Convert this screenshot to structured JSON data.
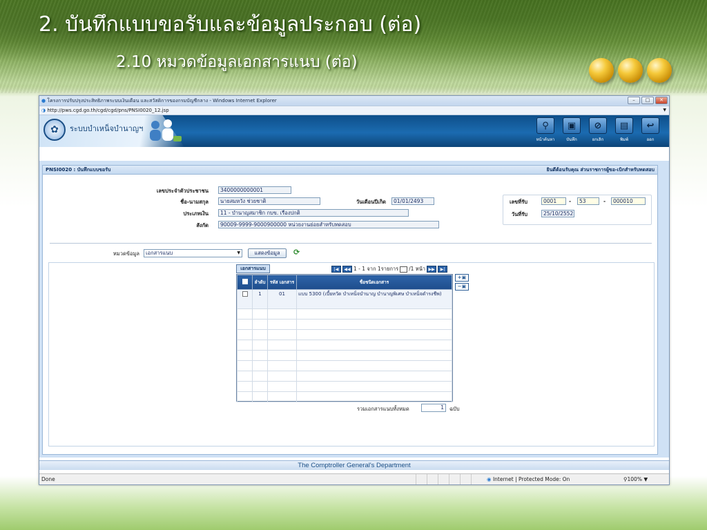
{
  "slide": {
    "title": "2. บันทึกแบบขอรับและข้อมูลประกอบ (ต่อ)",
    "subtitle": "2.10 หมวดข้อมูลเอกสารแนบ (ต่อ)"
  },
  "browser": {
    "window_title": "โครงการปรับปรุงประสิทธิภาพระบบเงินเดือน และสวัสดิการของกรมบัญชีกลาง - Windows Internet Explorer",
    "url": "http://pws.cgd.go.th/cgd/cgd/pns/PNSI0020_12.jsp",
    "status": "Done",
    "zone": "Internet | Protected Mode: On",
    "zoom": "100%"
  },
  "app": {
    "name": "ระบบบำเหน็จบำนาญฯ",
    "toolbar": [
      {
        "label": "หน้าค้นหา",
        "icon": "search-icon"
      },
      {
        "label": "บันทึก",
        "icon": "save-icon"
      },
      {
        "label": "ยกเลิก",
        "icon": "cancel-icon"
      },
      {
        "label": "พิมพ์",
        "icon": "print-icon"
      },
      {
        "label": "ออก",
        "icon": "exit-icon"
      }
    ],
    "footer": "The Comptroller General's Department"
  },
  "form": {
    "screen_title": "PNSI0020 : บันทึกแบบขอรับ",
    "welcome": "ยินดีต้อนรับคุณ ส่วนราชการผู้ขอ-เบิกสำหรับทดสอบ",
    "id_label": "เลขประจำตัวประชาชน",
    "id_value": "3400000000001",
    "name_label": "ชื่อ-นามสกุล",
    "name_value": "นายสมหวัง ช่วยชาติ",
    "birth_label": "วันเดือนปีเกิด",
    "birth_value": "01/01/2493",
    "type_label": "ประเภทเงิน",
    "type_value": "11 - บำนาญสมาชิก กบข. เรื่องปกติ",
    "unit_label": "สังกัด",
    "unit_value": "90009-9999-9000900000  หน่วยงานย่อยสำหรับทดสอบ",
    "recv_no_label": "เลขที่รับ",
    "recv_no_1": "0001",
    "recv_no_2": "53",
    "recv_no_3": "000010",
    "recv_date_label": "วันที่รับ",
    "recv_date": "25/10/2552",
    "category_label": "หมวดข้อมูล",
    "category_value": "เอกสารแนบ",
    "show_button": "แสดงข้อมูล"
  },
  "attachments": {
    "tab": "เอกสารแนบ",
    "pager_text": "1 - 1 จาก 1รายการ",
    "pager_page": "/1 หน้า",
    "columns": [
      "ลำดับ",
      "รหัส เอกสาร",
      "ชื่อชนิดเอกสาร"
    ],
    "rows": [
      {
        "no": "1",
        "code": "01",
        "name": "แบบ 5300 (เบี้ยหวัด บำเหน็จบำนาญ บำนาญพิเศษ บำเหน็จดำรงชีพ)"
      }
    ],
    "total_label": "รวมเอกสารแนบทั้งหมด",
    "total_value": "1",
    "total_unit": "ฉบับ"
  }
}
